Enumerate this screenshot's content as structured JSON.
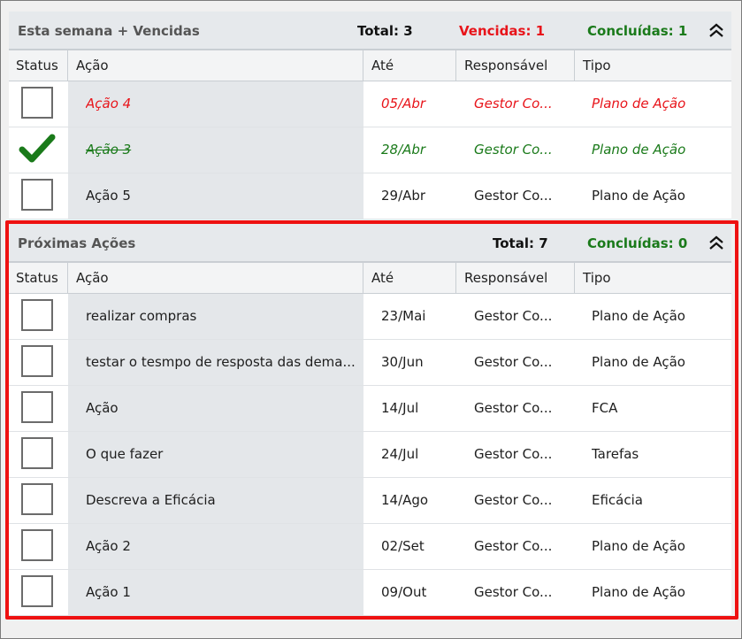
{
  "colors": {
    "overdue": "#e8141a",
    "done": "#1a7a1a",
    "highlight": "#ee1111"
  },
  "group1": {
    "title": "Esta semana + Vencidas",
    "total": "Total: 3",
    "vencidas": "Vencidas: 1",
    "concluidas": "Concluídas: 1",
    "columns": [
      "Status",
      "Ação",
      "Até",
      "Responsável",
      "Tipo"
    ],
    "rows": [
      {
        "acao": "Ação 4",
        "ate": "05/Abr",
        "responsavel": "Gestor Co...",
        "tipo": "Plano de Ação",
        "state": "overdue"
      },
      {
        "acao": "Ação 3",
        "ate": "28/Abr",
        "responsavel": "Gestor Co...",
        "tipo": "Plano de Ação",
        "state": "done"
      },
      {
        "acao": "Ação 5",
        "ate": "29/Abr",
        "responsavel": "Gestor Co...",
        "tipo": "Plano de Ação",
        "state": "open"
      }
    ]
  },
  "group2": {
    "title": "Próximas Ações",
    "total": "Total: 7",
    "concluidas": "Concluídas: 0",
    "columns": [
      "Status",
      "Ação",
      "Até",
      "Responsável",
      "Tipo"
    ],
    "rows": [
      {
        "acao": "realizar compras",
        "ate": "23/Mai",
        "responsavel": "Gestor Co...",
        "tipo": "Plano de Ação",
        "state": "open"
      },
      {
        "acao": "testar o tesmpo de resposta das dema...",
        "ate": "30/Jun",
        "responsavel": "Gestor Co...",
        "tipo": "Plano de Ação",
        "state": "open"
      },
      {
        "acao": "Ação",
        "ate": "14/Jul",
        "responsavel": "Gestor Co...",
        "tipo": "FCA",
        "state": "open"
      },
      {
        "acao": "O que fazer",
        "ate": "24/Jul",
        "responsavel": "Gestor Co...",
        "tipo": "Tarefas",
        "state": "open"
      },
      {
        "acao": "Descreva a Eficácia",
        "ate": "14/Ago",
        "responsavel": "Gestor Co...",
        "tipo": "Eficácia",
        "state": "open"
      },
      {
        "acao": "Ação 2",
        "ate": "02/Set",
        "responsavel": "Gestor Co...",
        "tipo": "Plano de Ação",
        "state": "open"
      },
      {
        "acao": "Ação 1",
        "ate": "09/Out",
        "responsavel": "Gestor Co...",
        "tipo": "Plano de Ação",
        "state": "open"
      }
    ]
  }
}
